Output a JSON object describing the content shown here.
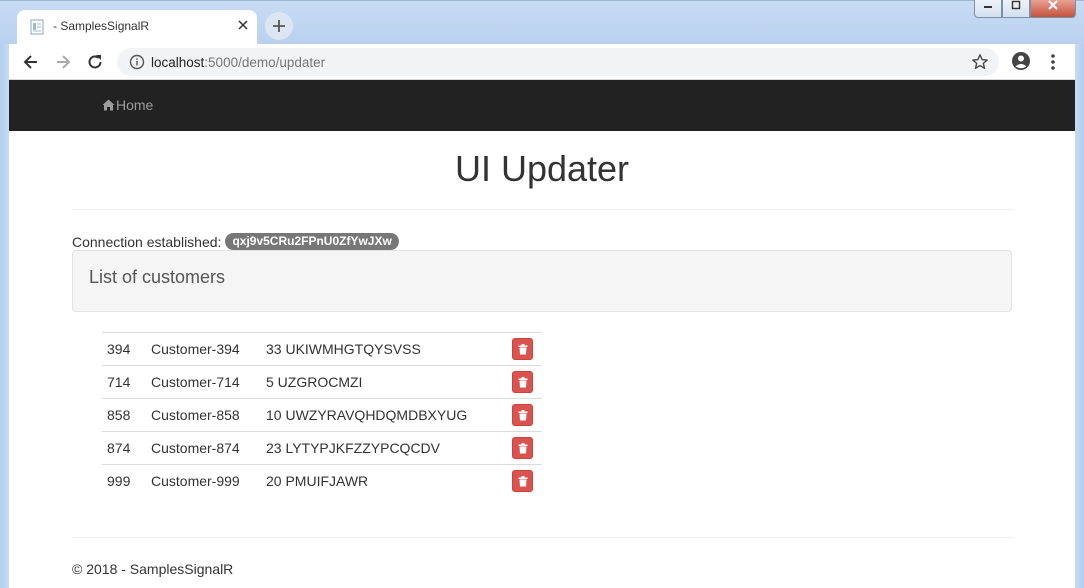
{
  "browser": {
    "tab_title": "- SamplesSignalR",
    "url_host": "localhost",
    "url_path": ":5000/demo/updater"
  },
  "navbar": {
    "home_label": "Home"
  },
  "page": {
    "title": "UI Updater",
    "connection_label": "Connection established:",
    "connection_id": "qxj9v5CRu2FPnU0ZfYwJXw",
    "list_heading": "List of customers"
  },
  "customers": [
    {
      "id": "394",
      "name": "Customer-394",
      "detail": "33 UKIWMHGTQYSVSS"
    },
    {
      "id": "714",
      "name": "Customer-714",
      "detail": "5 UZGROCMZI"
    },
    {
      "id": "858",
      "name": "Customer-858",
      "detail": "10 UWZYRAVQHDQMDBXYUG"
    },
    {
      "id": "874",
      "name": "Customer-874",
      "detail": "23 LYTYPJKFZZYPCQCDV"
    },
    {
      "id": "999",
      "name": "Customer-999",
      "detail": "20 PMUIFJAWR"
    }
  ],
  "footer": {
    "text": "© 2018 - SamplesSignalR"
  },
  "icons": {
    "favicon": "page-icon",
    "close": "close-icon",
    "new_tab": "plus-icon",
    "back": "back-arrow-icon",
    "forward": "forward-arrow-icon",
    "reload": "reload-icon",
    "info": "info-icon",
    "bookmark": "star-icon",
    "profile": "profile-icon",
    "menu": "kebab-menu-icon",
    "home": "home-icon",
    "delete": "trash-icon"
  },
  "colors": {
    "navbar": "#222222",
    "badge": "#777777",
    "delete_button": "#d9534f"
  }
}
